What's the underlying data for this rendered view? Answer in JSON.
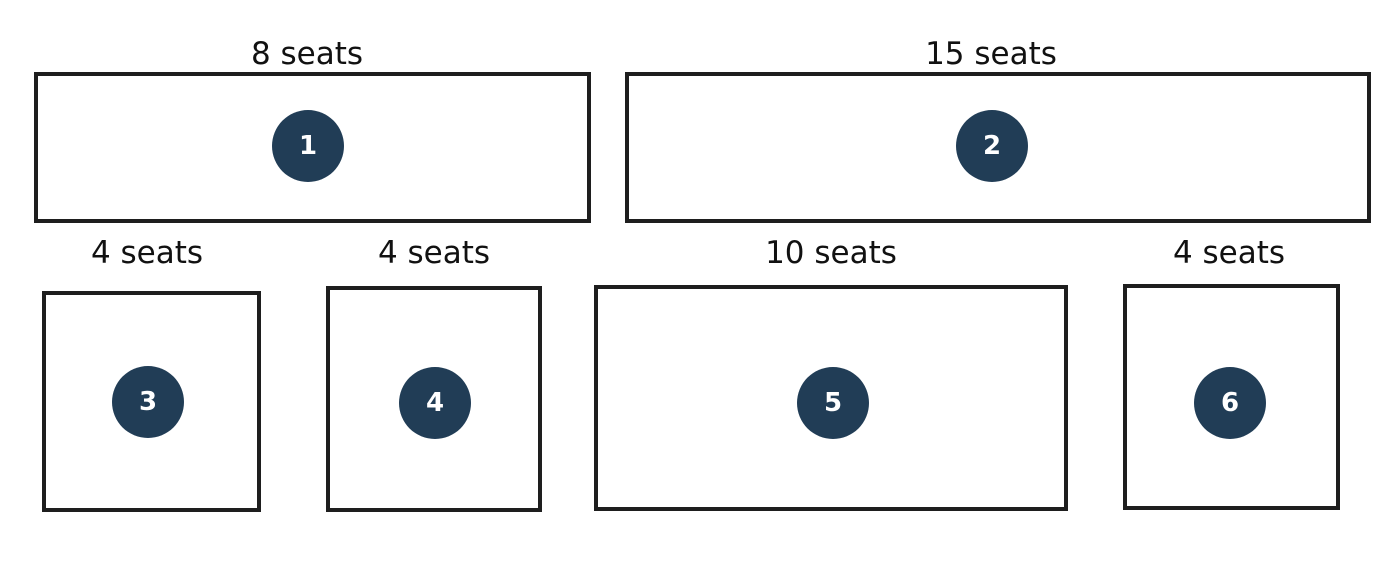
{
  "colors": {
    "marker_fill": "#213d56",
    "marker_text": "#ffffff",
    "outline": "#1e1e1e"
  },
  "tables": [
    {
      "number": "1",
      "seats_label": "8 seats"
    },
    {
      "number": "2",
      "seats_label": "15 seats"
    },
    {
      "number": "3",
      "seats_label": "4 seats"
    },
    {
      "number": "4",
      "seats_label": "4 seats"
    },
    {
      "number": "5",
      "seats_label": "10 seats"
    },
    {
      "number": "6",
      "seats_label": "4 seats"
    }
  ]
}
